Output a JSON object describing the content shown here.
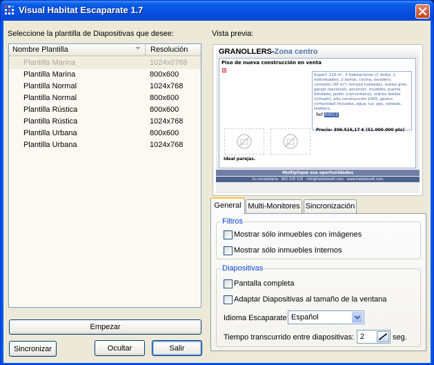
{
  "window": {
    "title": "Visual Habitat Escaparate 1.7"
  },
  "left": {
    "prompt": "Seleccione la plantilla de Diapositivas que desee:",
    "list": {
      "columns": [
        "Nombre Plantilla",
        "Resolución"
      ],
      "rows": [
        {
          "name": "Plantilla Marina",
          "res": "1024x0768"
        },
        {
          "name": "Plantilla Marina",
          "res": "800x600"
        },
        {
          "name": "Plantilla Normal",
          "res": "1024x768"
        },
        {
          "name": "Plantilla Normal",
          "res": "800x600"
        },
        {
          "name": "Plantilla Rústica",
          "res": "800x600"
        },
        {
          "name": "Plantilla Rústica",
          "res": "1024x768"
        },
        {
          "name": "Plantilla Urbana",
          "res": "800x600"
        },
        {
          "name": "Plantilla Urbana",
          "res": "1024x768"
        }
      ]
    },
    "buttons": {
      "start": "Empezar",
      "sync": "Sincronizar",
      "hide": "Ocultar",
      "exit": "Salir"
    }
  },
  "preview": {
    "label": "Vista previa:",
    "title_part1": "GRANOLLERS-",
    "title_part2": "Zona centro",
    "subtitle": "Piso de nueva construcción en venta",
    "description": "Superf. 110 m², 3 habitaciones (1 doble, 2 individuales), 2 baños, cocina, lavadero, comedor (30 m²), terraza (soleada), suelos gres, garaje (opcional), ascensor, muebles, puerta blindada, jardín (comunitario), vidrios dobles (climalit), año construcción 2005, gastos comunidad incluidos, agua, luz, gas, soleado, teléfono.",
    "ref_label": "Ref:",
    "ref_value": "00013",
    "price": "Precio: 306.516,17 € (51.000.000 pts)",
    "note": "Ideal parejas.",
    "footer": "Multiplique sus oportunidades",
    "footer_small": "Su inmobiliaria · 902 220 125 · info@habitatsoft.com · www.habitatsoft.com"
  },
  "tabs": [
    "General",
    "Multi-Monitores",
    "Sincronización"
  ],
  "general": {
    "filters_title": "Filtros",
    "filter_images": "Mostrar sólo inmuebles con imágenes",
    "filter_internal": "Mostrar sólo inmuebles Internos",
    "slides_title": "Diapositivas",
    "fullscreen": "Pantalla completa",
    "adapt": "Adaptar Diapositivas al tamaño de la ventana",
    "language_label": "Idioma Escaparate",
    "language_value": "Español",
    "time_label": "Tiempo transcurrido entre diapositivas:",
    "time_value": "2",
    "time_unit": "seg."
  }
}
